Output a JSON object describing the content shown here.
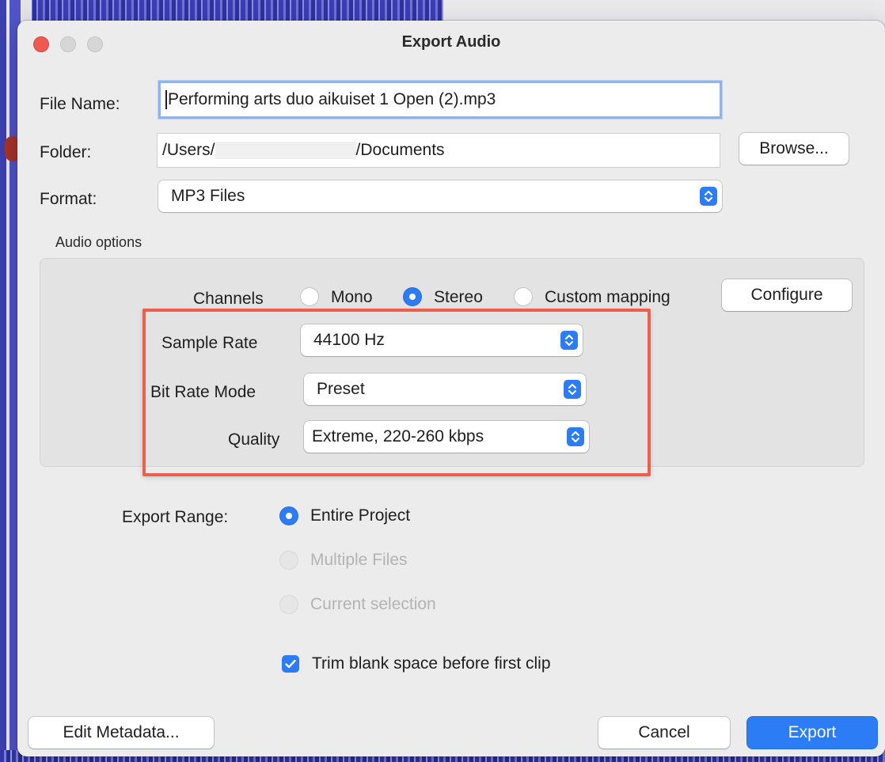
{
  "dialog": {
    "title": "Export Audio",
    "file_name_label": "File Name:",
    "file_name_value": "Performing arts duo aikuiset 1 Open (2).mp3",
    "folder_label": "Folder:",
    "folder_value_prefix": "/Users/",
    "folder_value_suffix": "/Documents",
    "browse_label": "Browse...",
    "format_label": "Format:",
    "format_value": "MP3 Files",
    "audio_options_label": "Audio options",
    "channels": {
      "label": "Channels",
      "options": [
        "Mono",
        "Stereo",
        "Custom mapping"
      ],
      "selected": "Stereo"
    },
    "configure_label": "Configure",
    "sample_rate_label": "Sample Rate",
    "sample_rate_value": "44100 Hz",
    "bit_rate_mode_label": "Bit Rate Mode",
    "bit_rate_mode_value": "Preset",
    "quality_label": "Quality",
    "quality_value": "Extreme, 220-260 kbps",
    "export_range": {
      "label": "Export Range:",
      "options": [
        "Entire Project",
        "Multiple Files",
        "Current selection"
      ],
      "selected": "Entire Project"
    },
    "trim_label": "Trim blank space before first clip",
    "trim_checked": true,
    "edit_metadata_label": "Edit Metadata...",
    "cancel_label": "Cancel",
    "export_label": "Export"
  },
  "colors": {
    "accent": "#2c7cf6",
    "highlight": "#ec5f4c",
    "close_button": "#ee5a52"
  },
  "icons": {
    "stepper": "up-down-chevron-icon",
    "check": "checkmark-icon"
  }
}
